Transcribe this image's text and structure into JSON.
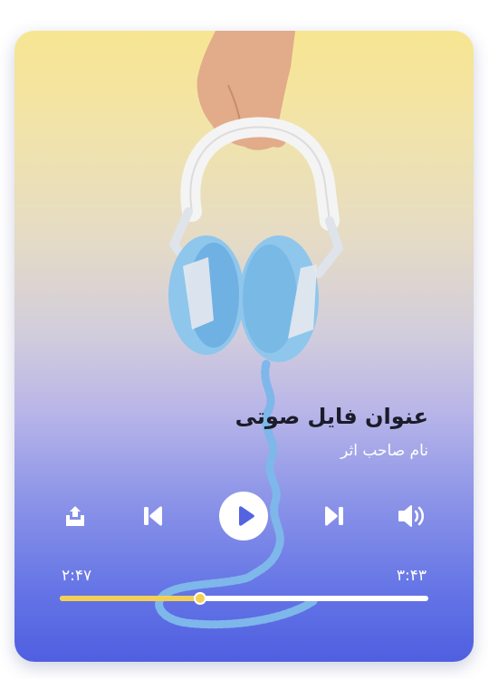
{
  "track": {
    "title": "عنوان فایل صوتی",
    "artist": "نام صاحب اثر",
    "elapsed": "۲:۴۷",
    "total": "۳:۴۳",
    "progress": 0.38
  },
  "controls": {
    "share_icon": "share-icon",
    "previous_icon": "skip-previous-icon",
    "play_icon": "play-icon",
    "next_icon": "skip-next-icon",
    "volume_icon": "volume-icon"
  },
  "colors": {
    "progress_fill": "#f4cf56",
    "progress_track": "#ffffff",
    "card_top": "#f7e591",
    "card_bottom": "#4f5fe0"
  }
}
